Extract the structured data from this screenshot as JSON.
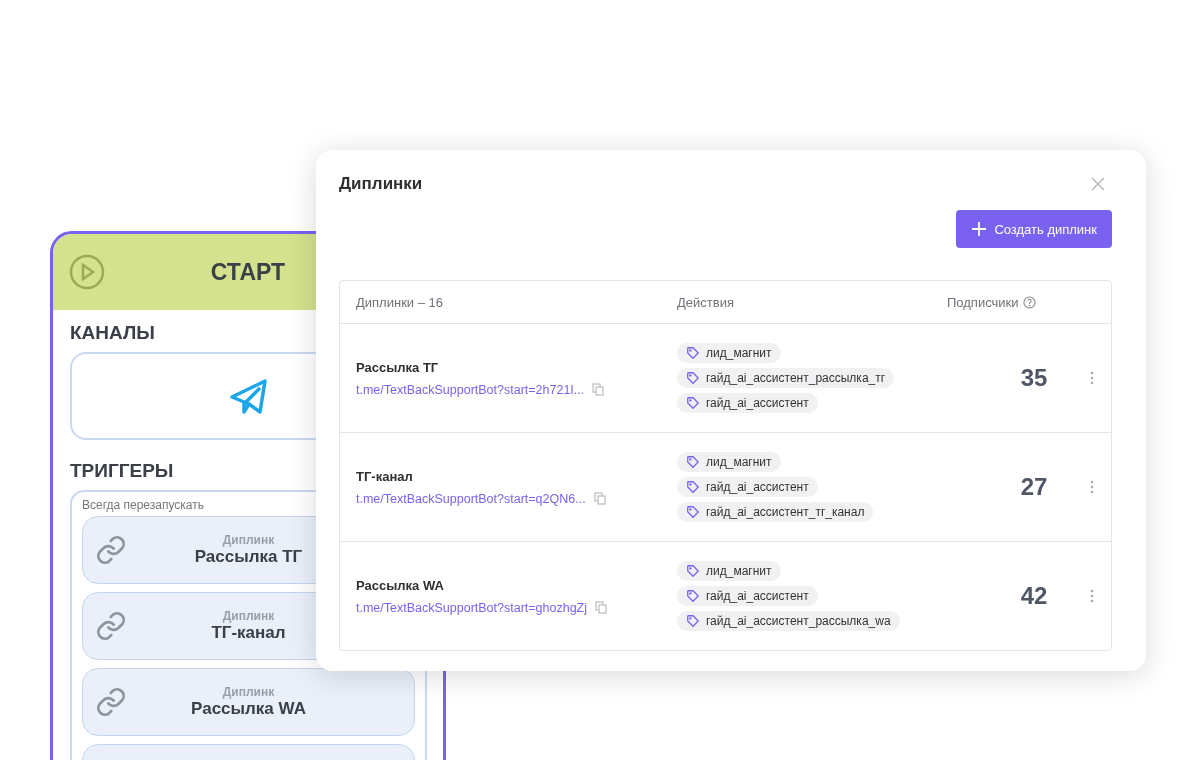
{
  "start_node": {
    "title": "СТАРТ",
    "channels_heading": "КАНАЛЫ",
    "triggers_heading": "ТРИГГЕРЫ",
    "triggers_note": "Всегда перезапускать",
    "triggers": [
      {
        "type": "Диплинк",
        "name": "Рассылка ТГ"
      },
      {
        "type": "Диплинк",
        "name": "ТГ-канал"
      },
      {
        "type": "Диплинк",
        "name": "Рассылка WA"
      }
    ],
    "more_triggers_below": true
  },
  "modal": {
    "title": "Диплинки",
    "create_button": "Создать диплинк",
    "columns": [
      "Диплинки – 16",
      "Действия",
      "Подписчики"
    ],
    "rows": [
      {
        "name": "Рассылка ТГ",
        "link": "t.me/TextBackSupportBot?start=2h721I...",
        "tags": [
          "лид_магнит",
          "гайд_ai_ассистент_рассылка_тг",
          "гайд_ai_ассистент"
        ],
        "subscribers": "35"
      },
      {
        "name": "ТГ-канал",
        "link": "t.me/TextBackSupportBot?start=q2QN6...",
        "tags": [
          "лид_магнит",
          "гайд_ai_ассистент",
          "гайд_ai_ассистент_тг_канал"
        ],
        "subscribers": "27"
      },
      {
        "name": "Рассылка WA",
        "link": "t.me/TextBackSupportBot?start=ghozhgZj",
        "tags": [
          "лид_магнит",
          "гайд_ai_ассистент",
          "гайд_ai_ассистент_рассылка_wa"
        ],
        "subscribers": "42"
      }
    ]
  }
}
